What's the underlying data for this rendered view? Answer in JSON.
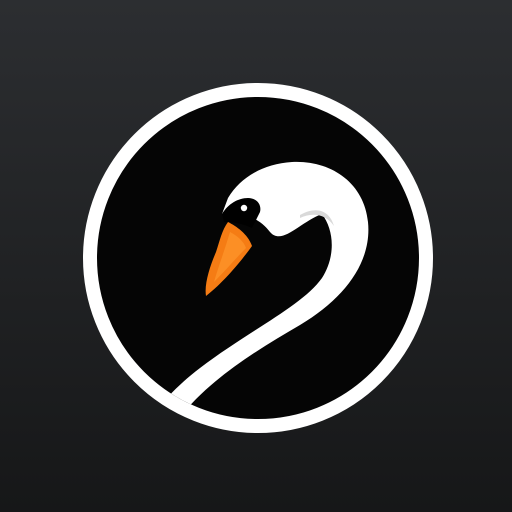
{
  "app_icon": {
    "icon": "swan-logo-icon",
    "colors": {
      "background_top": "#2c2e31",
      "background_bottom": "#161718",
      "disc": "#050505",
      "ring": "#ffffff",
      "swan_body": "#ffffff",
      "swan_shadow": "#d9d9d9",
      "beak": "#f57c14",
      "beak_highlight": "#ff9a2e",
      "eye_mask": "#000000"
    }
  }
}
